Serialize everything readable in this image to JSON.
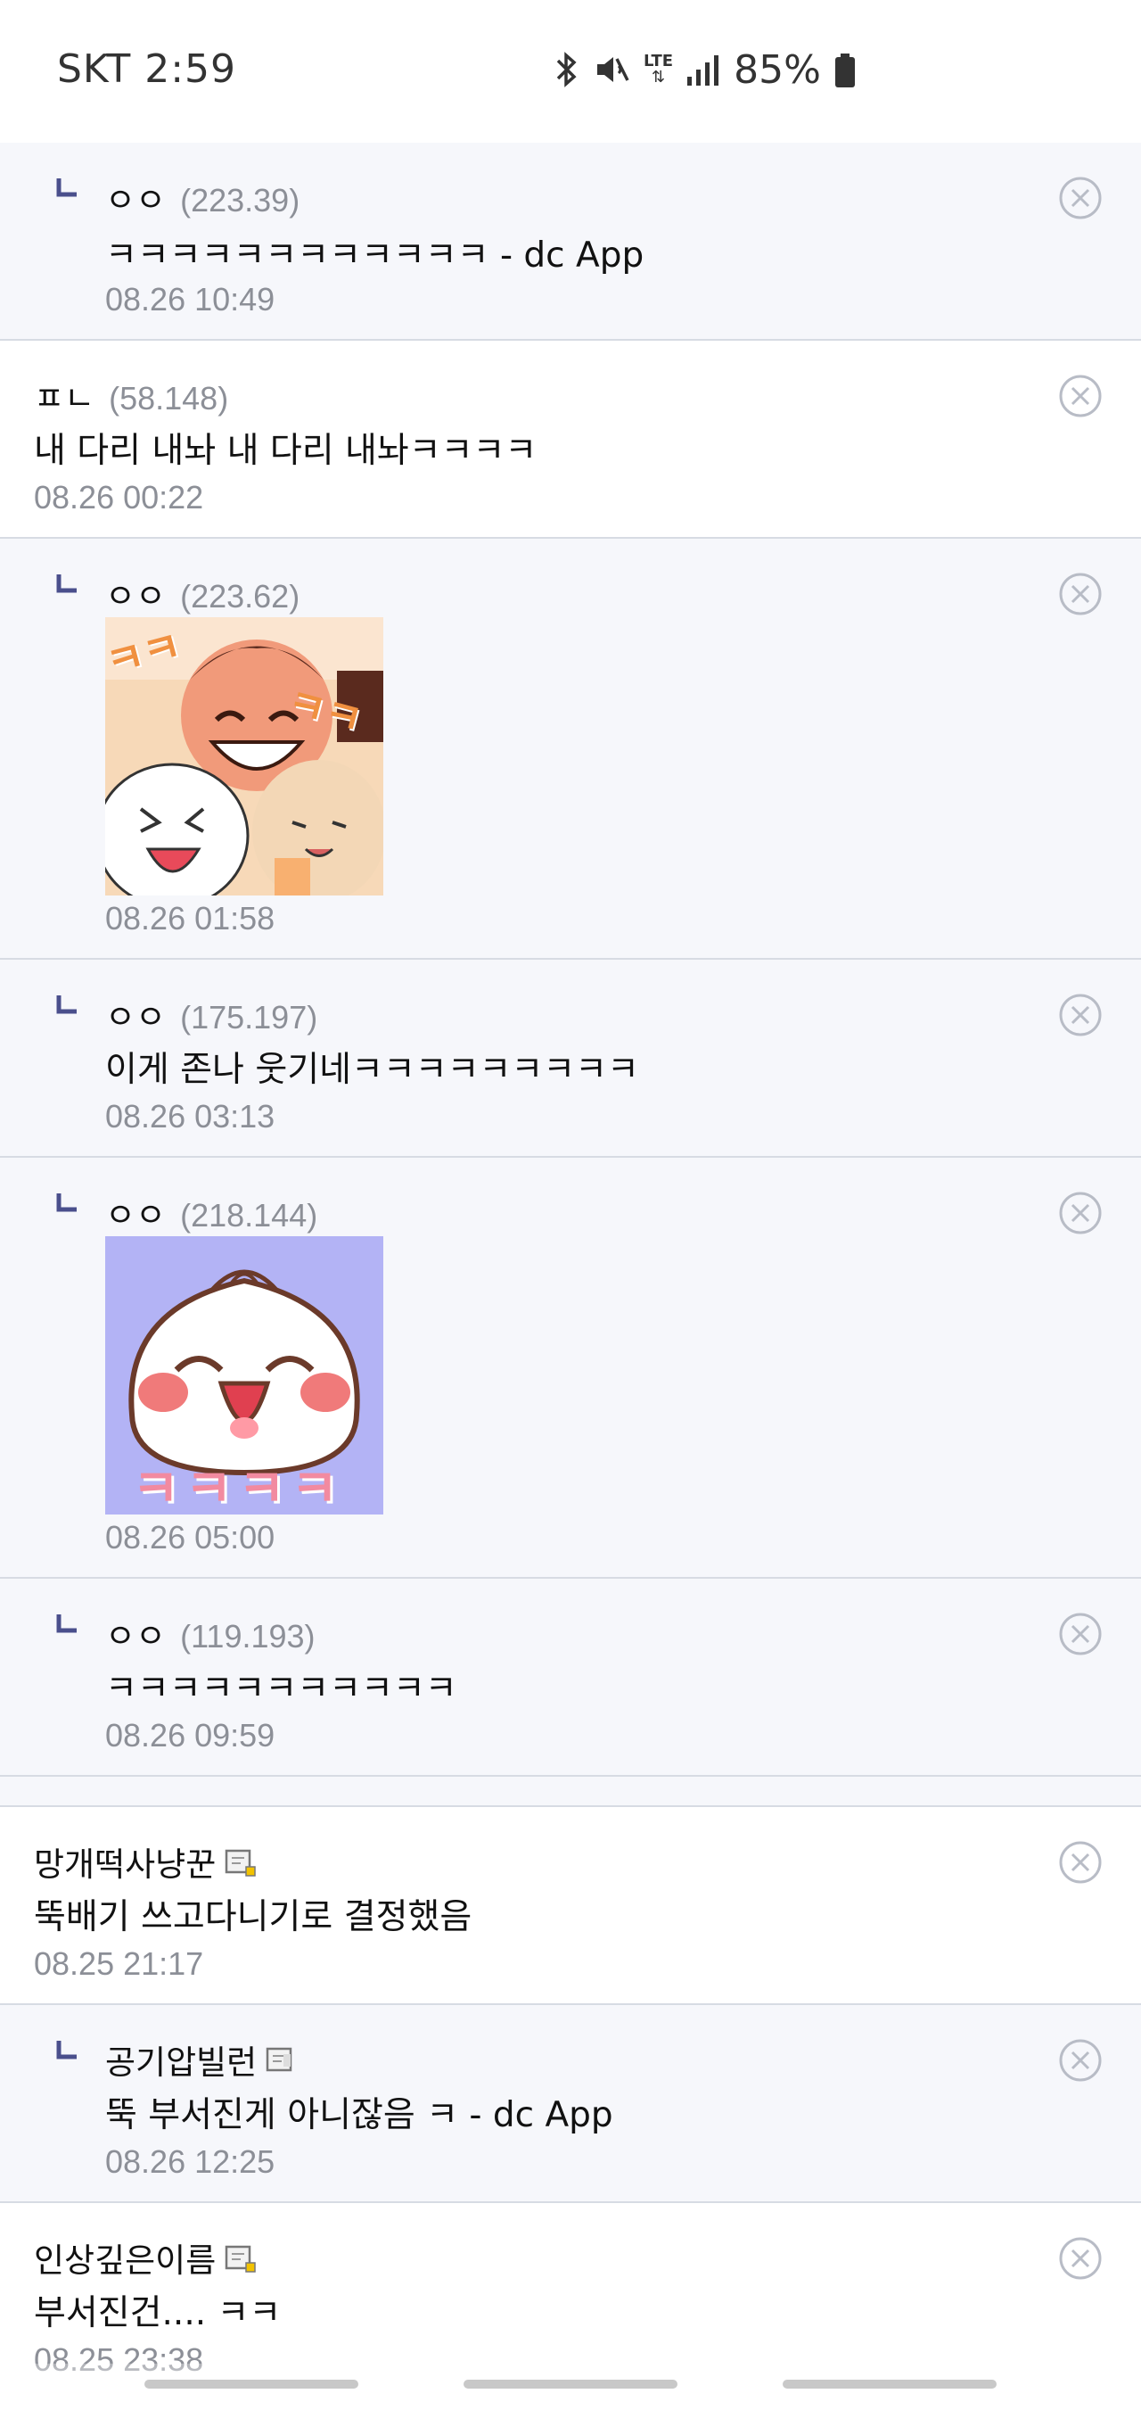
{
  "status_bar": {
    "left": "SKT 2:59",
    "network": "LTE",
    "battery": "85%",
    "icons": [
      "bluetooth-icon",
      "mute-icon",
      "lte-icon",
      "signal-icon",
      "battery-icon"
    ]
  },
  "comments": [
    {
      "type": "reply",
      "nick": "ㅇㅇ",
      "ip": "(223.39)",
      "text": "ㅋㅋㅋㅋㅋㅋㅋㅋㅋㅋㅋㅋ - dc App",
      "time": "08.26 10:49"
    },
    {
      "type": "top",
      "nick": "ㅍㄴ",
      "ip": "(58.148)",
      "text": "내 다리 내놔 내 다리 내놔ㅋㅋㅋㅋ",
      "time": "08.26 00:22"
    },
    {
      "type": "reply",
      "nick": "ㅇㅇ",
      "ip": "(223.62)",
      "sticker": "laughing-people-sticker",
      "time": "08.26 01:58"
    },
    {
      "type": "reply",
      "nick": "ㅇㅇ",
      "ip": "(175.197)",
      "text": "이게 존나 웃기네ㅋㅋㅋㅋㅋㅋㅋㅋㅋ",
      "time": "08.26 03:13"
    },
    {
      "type": "reply",
      "nick": "ㅇㅇ",
      "ip": "(218.144)",
      "sticker": "laughing-dumpling-sticker",
      "time": "08.26 05:00"
    },
    {
      "type": "reply",
      "nick": "ㅇㅇ",
      "ip": "(119.193)",
      "text": "ㅋㅋㅋㅋㅋㅋㅋㅋㅋㅋㅋ",
      "time": "08.26 09:59"
    },
    {
      "type": "top",
      "nick": "망개떡사냥꾼",
      "gallog": true,
      "text": "뚝배기 쓰고다니기로 결정했음",
      "time": "08.25 21:17"
    },
    {
      "type": "reply",
      "nick": "공기압빌런",
      "gallog": true,
      "text": "뚝 부서진게 아니잖음 ㅋ - dc App",
      "time": "08.26 12:25"
    },
    {
      "type": "top",
      "nick": "인상깊은이름",
      "gallog": true,
      "text": "부서진건.... ㅋㅋ",
      "time": "08.25 23:38"
    }
  ],
  "sticker_text": {
    "laughing": "ㅋㅋ",
    "dumpling": "ㅋㅋㅋㅋ"
  },
  "colors": {
    "reply_mark": "#4a4f8c",
    "ip_gray": "#8c8f97",
    "divider": "#d7dbe3"
  }
}
